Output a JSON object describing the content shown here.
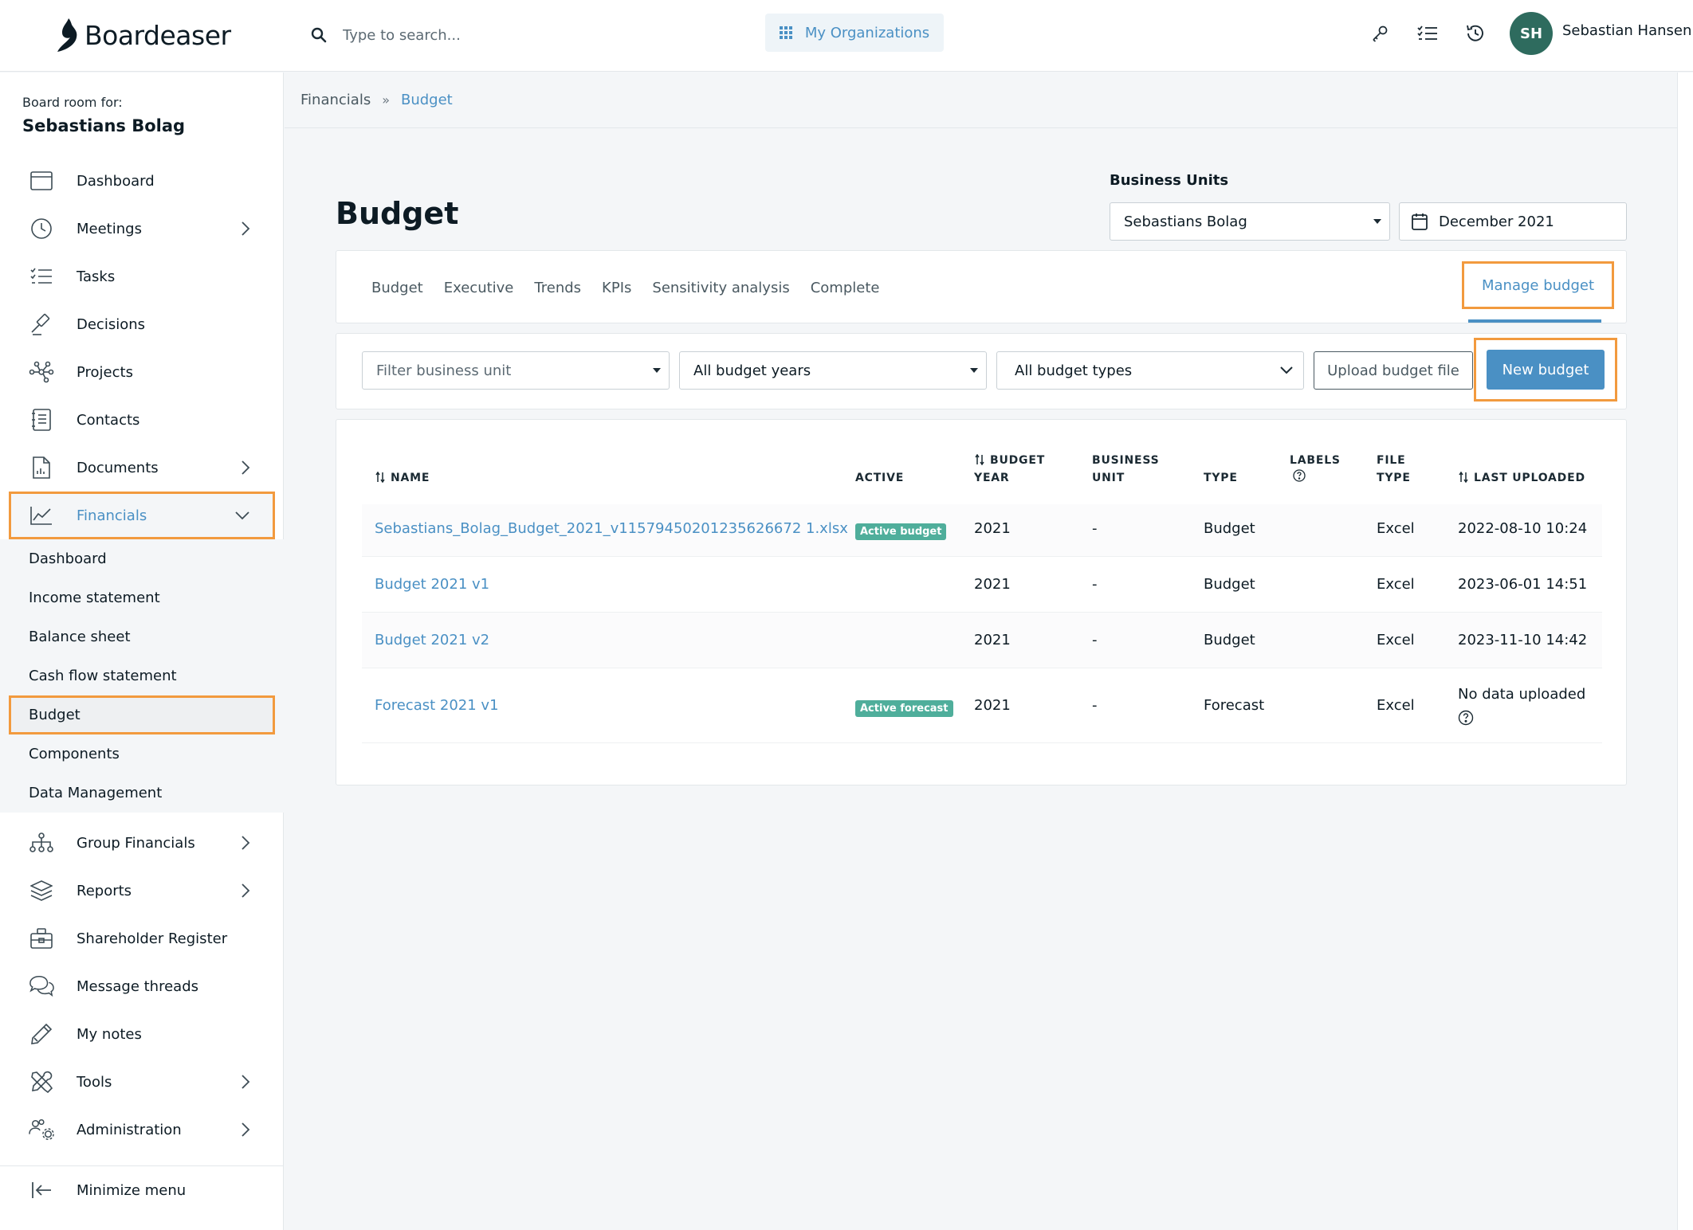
{
  "brand": {
    "name": "Boardeaser"
  },
  "search": {
    "placeholder": "Type to search..."
  },
  "header": {
    "org_button": "My Organizations",
    "icons": [
      "key-icon",
      "task-list-icon",
      "history-icon"
    ],
    "user": {
      "initials": "SH",
      "name": "Sebastian Hansen"
    }
  },
  "sidebar": {
    "board_label": "Board room for:",
    "board_name": "Sebastians Bolag",
    "items_top": [
      {
        "label": "Dashboard",
        "icon": "calendar-icon"
      },
      {
        "label": "Meetings",
        "icon": "clock-icon"
      },
      {
        "label": "Tasks",
        "icon": "task-list-icon"
      },
      {
        "label": "Decisions",
        "icon": "gavel-icon"
      },
      {
        "label": "Projects",
        "icon": "network-icon"
      },
      {
        "label": "Contacts",
        "icon": "contacts-book-icon"
      },
      {
        "label": "Documents",
        "icon": "document-icon"
      },
      {
        "label": "Financials",
        "icon": "line-chart-icon"
      }
    ],
    "financials_sub": [
      "Dashboard",
      "Income statement",
      "Balance sheet",
      "Cash flow statement",
      "Budget",
      "Components",
      "Data Management"
    ],
    "items_bottom": [
      {
        "label": "Group Financials",
        "icon": "org-chart-icon"
      },
      {
        "label": "Reports",
        "icon": "layers-icon"
      },
      {
        "label": "Shareholder Register",
        "icon": "briefcase-icon"
      },
      {
        "label": "Message threads",
        "icon": "chat-icon"
      },
      {
        "label": "My notes",
        "icon": "pencil-icon"
      },
      {
        "label": "Tools",
        "icon": "tools-icon"
      },
      {
        "label": "Administration",
        "icon": "users-gear-icon"
      }
    ],
    "minimize": "Minimize menu"
  },
  "breadcrumb": {
    "parent": "Financials",
    "current": "Budget"
  },
  "page": {
    "title": "Budget",
    "business_units_label": "Business Units",
    "business_unit_value": "Sebastians Bolag",
    "date_value": "December 2021"
  },
  "tabs": {
    "items": [
      "Budget",
      "Executive",
      "Trends",
      "KPIs",
      "Sensitivity analysis",
      "Complete"
    ],
    "manage": "Manage budget"
  },
  "filters": {
    "business_unit_placeholder": "Filter business unit",
    "years_value": "All budget years",
    "types_value": "All budget types",
    "upload_label": "Upload budget file",
    "new_label": "New budget"
  },
  "table": {
    "headers": {
      "name": "NAME",
      "active": "ACTIVE",
      "budget_year_1": "BUDGET",
      "budget_year_2": "YEAR",
      "business_unit_1": "BUSINESS",
      "business_unit_2": "UNIT",
      "type": "TYPE",
      "labels": "LABELS",
      "file_type_1": "FILE",
      "file_type_2": "TYPE",
      "last_uploaded": "LAST UPLOADED"
    },
    "rows": [
      {
        "name": "Sebastians_Bolag_Budget_2021_v11579450201235626672 1.xlsx",
        "active": "Active budget",
        "year": "2021",
        "unit": "-",
        "type": "Budget",
        "file_type": "Excel",
        "uploaded": "2022-08-10 10:24"
      },
      {
        "name": "Budget 2021 v1",
        "active": "",
        "year": "2021",
        "unit": "-",
        "type": "Budget",
        "file_type": "Excel",
        "uploaded": "2023-06-01 14:51"
      },
      {
        "name": "Budget 2021 v2",
        "active": "",
        "year": "2021",
        "unit": "-",
        "type": "Budget",
        "file_type": "Excel",
        "uploaded": "2023-11-10 14:42"
      },
      {
        "name": "Forecast 2021 v1",
        "active": "Active forecast",
        "year": "2021",
        "unit": "-",
        "type": "Forecast",
        "file_type": "Excel",
        "uploaded": "No data uploaded"
      }
    ]
  },
  "colors": {
    "accent": "#4a90c4",
    "highlight": "#f29a3e",
    "badge": "#4fae9b",
    "avatar": "#2e6b5e"
  }
}
